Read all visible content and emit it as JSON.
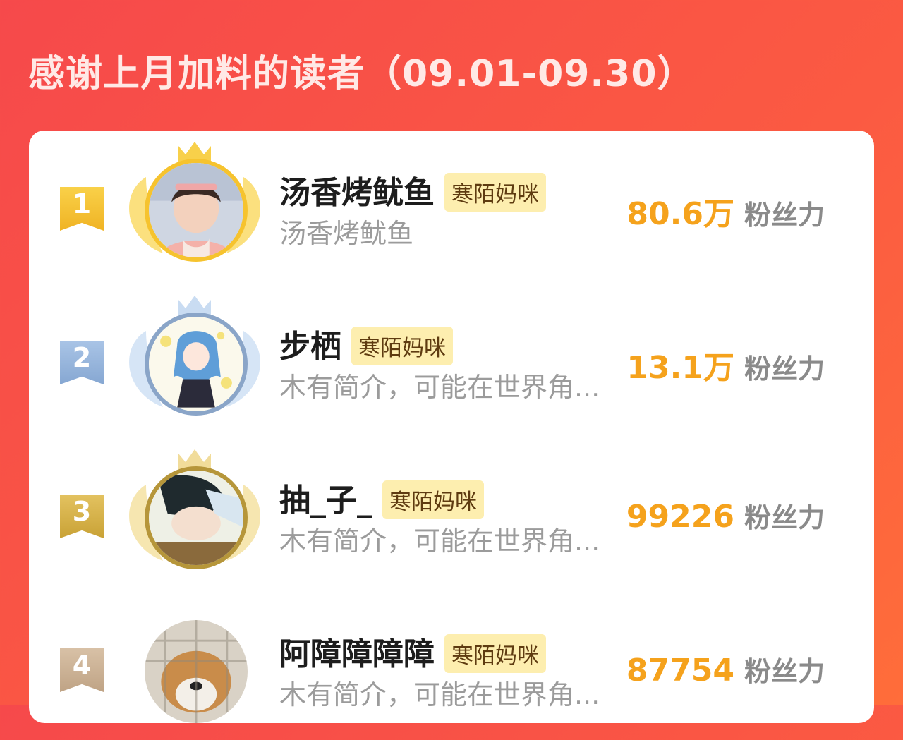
{
  "page_title": "感谢上月加料的读者（09.01-09.30）",
  "colors": {
    "background": "#f6494b",
    "gold": "#f6c32e",
    "silver": "#9ab6dc",
    "bronze": "#d8b24a",
    "fans_value": "#f5a21c",
    "tag_bg": "#fdeeaf"
  },
  "readers": [
    {
      "rank": "1",
      "name": "汤香烤鱿鱼",
      "tag": "寒陌妈咪",
      "description": "汤香烤鱿鱼",
      "fans_value": "80.6万",
      "fans_unit": "粉丝力"
    },
    {
      "rank": "2",
      "name": "步栖",
      "tag": "寒陌妈咪",
      "description": "木有简介，可能在世界角...",
      "fans_value": "13.1万",
      "fans_unit": "粉丝力"
    },
    {
      "rank": "3",
      "name": "抽_子_",
      "tag": "寒陌妈咪",
      "description": "木有简介，可能在世界角...",
      "fans_value": "99226",
      "fans_unit": "粉丝力"
    },
    {
      "rank": "4",
      "name": "阿障障障障",
      "tag": "寒陌妈咪",
      "description": "木有简介，可能在世界角...",
      "fans_value": "87754",
      "fans_unit": "粉丝力"
    }
  ]
}
